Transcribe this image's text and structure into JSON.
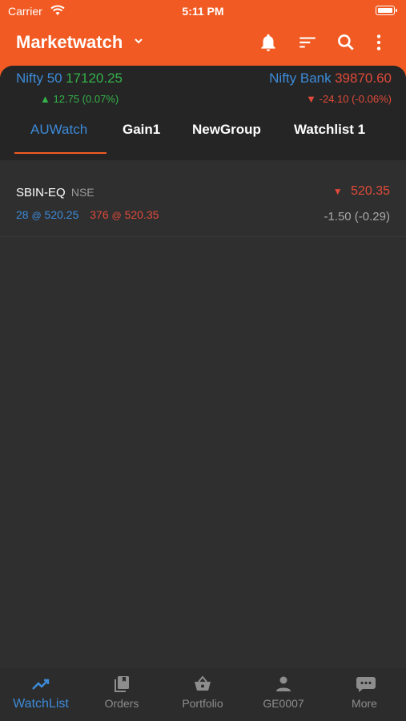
{
  "status_bar": {
    "carrier": "Carrier",
    "time": "5:11 PM"
  },
  "header": {
    "title": "Marketwatch",
    "icons": [
      "bell-icon",
      "sort-icon",
      "search-icon",
      "more-vert-icon"
    ]
  },
  "indices": [
    {
      "name": "Nifty 50",
      "value": "17120.25",
      "change": "12.75",
      "change_pct": "(0.07%)",
      "direction": "up"
    },
    {
      "name": "Nifty Bank",
      "value": "39870.60",
      "change": "-24.10",
      "change_pct": "(-0.06%)",
      "direction": "down"
    }
  ],
  "tabs": [
    {
      "label": "AUWatch",
      "active": true
    },
    {
      "label": "Gain1",
      "active": false
    },
    {
      "label": "NewGroup",
      "active": false
    },
    {
      "label": "Watchlist 1",
      "active": false
    }
  ],
  "watchlist": [
    {
      "symbol": "SBIN-EQ",
      "exchange": "NSE",
      "bid_qty": "28",
      "bid_price": "520.25",
      "ask_qty": "376",
      "ask_price": "520.35",
      "ltp": "520.35",
      "change": "-1.50 (-0.29)",
      "direction": "down"
    }
  ],
  "bottom_nav": [
    {
      "label": "WatchList",
      "icon": "trending-up-icon",
      "active": true
    },
    {
      "label": "Orders",
      "icon": "orders-icon",
      "active": false
    },
    {
      "label": "Portfolio",
      "icon": "basket-icon",
      "active": false
    },
    {
      "label": "GE0007",
      "icon": "person-icon",
      "active": false
    },
    {
      "label": "More",
      "icon": "more-icon",
      "active": false
    }
  ],
  "colors": {
    "header": "#f15a22",
    "panel": "#252525",
    "background": "#2f2f2f",
    "accent_blue": "#3d8bd9",
    "up_green": "#34b24a",
    "down_red": "#e04a3a"
  }
}
